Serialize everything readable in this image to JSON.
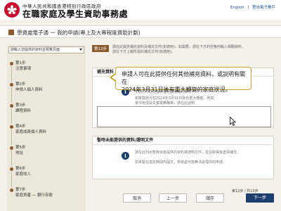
{
  "header": {
    "gov_line": "中華人民共和國香港特別行政區政府",
    "agency": "在職家庭及學生資助事務處",
    "links": [
      "English",
      "|",
      "登出電子帳戶"
    ]
  },
  "page": {
    "title": "學資處電子通 一 我的申請(專上及大專程度資助計劃)"
  },
  "sidebar": {
    "select_label": "請輸入您提供的資料並預覽頁面",
    "steps": [
      {
        "num": "第1步",
        "name": "注意事項"
      },
      {
        "num": "第2步",
        "name": "申請人個人資料"
      },
      {
        "num": "第3步",
        "name": "課程資料"
      },
      {
        "num": "第4步",
        "name": "家庭成員個人資料"
      },
      {
        "num": "第5步",
        "name": "地址"
      },
      {
        "num": "第6步",
        "name": "家庭收入"
      },
      {
        "num": "第7步",
        "name": "家庭資產 — 銀行存款"
      }
    ]
  },
  "main": {
    "step_label": "第12步",
    "desc_line1": "請在此提供補充資料及補充文件(如適用)。如需要，請在下方的空格內輸入相關資料。",
    "desc_line2": "請在下方上載所需的補充文件(如適用)。",
    "supplement": {
      "heading": "補充資料",
      "item1": "申請人可在此提供任何其他補充資料",
      "item2": "如家庭狀況在2024年3月31日後有重大轉變，例如：",
      "item3": "家中有成員失業或轉職等，請在此說明"
    },
    "pending": {
      "heading": "暫時未能提供的資料/證明文件",
      "line1": "請在此列出暫時未能提供的資料或證明文件，並在取得後盡快補交。",
      "line2": "如未能在指定時間內提交，學資處可能無法處理你的申請。"
    }
  },
  "tooltip": {
    "line1": "申請人可在此提供任何其他補充資料，或說明有關在",
    "line2": "2024年3月31日後有重大轉變的家庭狀況。"
  },
  "nav": {
    "cancel": "取消",
    "prev": "上一步",
    "save": "儲存",
    "next": "下一步",
    "page_indicator": "第12步 / 共13步"
  }
}
